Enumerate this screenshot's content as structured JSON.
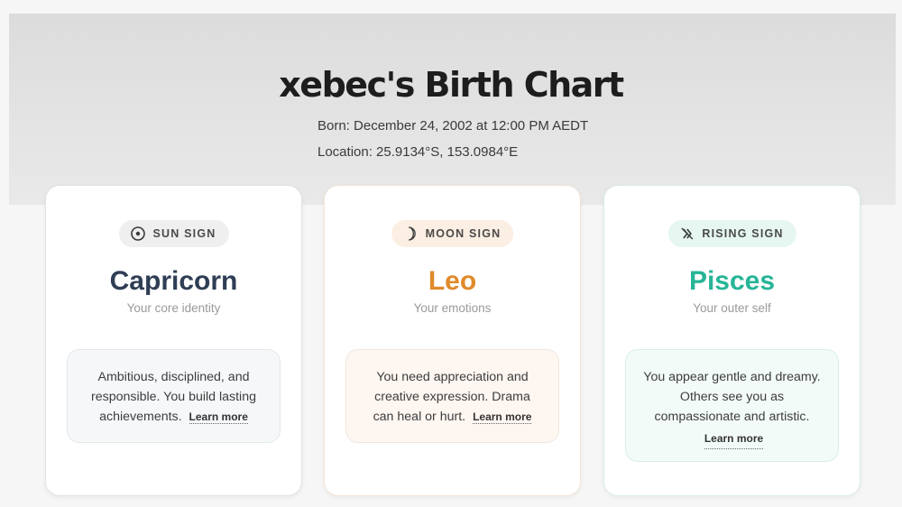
{
  "header": {
    "title": "xebec's Birth Chart",
    "born": "Born: December 24, 2002 at 12:00 PM AEDT",
    "location": "Location: 25.9134°S, 153.0984°E"
  },
  "cards": [
    {
      "badge": "SUN SIGN",
      "icon": "sun-icon",
      "sign": "Capricorn",
      "subtitle": "Your core identity",
      "description": "Ambitious, disciplined, and responsible. You build lasting achievements.",
      "link": "Learn more",
      "color": "#2f3e55"
    },
    {
      "badge": "MOON SIGN",
      "icon": "moon-icon",
      "sign": "Leo",
      "subtitle": "Your emotions",
      "description": "You need appreciation and creative expression. Drama can heal or hurt.",
      "link": "Learn more",
      "color": "#e08a2a"
    },
    {
      "badge": "RISING SIGN",
      "icon": "rising-icon",
      "sign": "Pisces",
      "subtitle": "Your outer self",
      "description": "You appear gentle and dreamy. Others see you as compassionate and artistic.",
      "link": "Learn more",
      "color": "#27b597"
    }
  ]
}
